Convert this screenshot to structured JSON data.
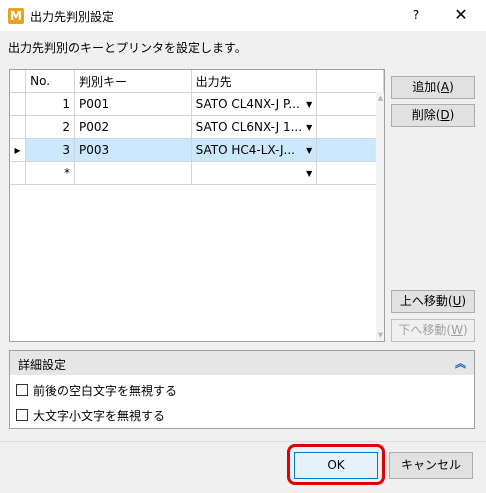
{
  "window": {
    "icon_letter": "M",
    "title": "出力先判別設定",
    "help_label": "?",
    "close_label": "✕"
  },
  "description": "出力先判別のキーとプリンタを設定します。",
  "grid": {
    "columns": [
      "No.",
      "判別キー",
      "出力先"
    ],
    "rows": [
      {
        "no": "1",
        "key": "P001",
        "dest": "SATO CL4NX-J P...",
        "selected": false
      },
      {
        "no": "2",
        "key": "P002",
        "dest": "SATO CL6NX-J 1...",
        "selected": false
      },
      {
        "no": "3",
        "key": "P003",
        "dest": "SATO HC4-LX-J...",
        "selected": true
      }
    ],
    "new_row_marker": "*",
    "current_row_marker": "▸",
    "dropdown_arrow": "▼",
    "scroll_up": "▲",
    "scroll_down": "▼"
  },
  "side_buttons": {
    "add": {
      "text": "追加(",
      "key": "A",
      "end": ")"
    },
    "delete": {
      "text": "削除(",
      "key": "D",
      "end": ")"
    },
    "move_up": {
      "text": "上へ移動(",
      "key": "U",
      "end": ")"
    },
    "move_down": {
      "text": "下へ移動(",
      "key": "W",
      "end": ")"
    }
  },
  "detail": {
    "title": "詳細設定",
    "collapse_icon": "︽",
    "options": [
      {
        "label": "前後の空白文字を無視する",
        "checked": false
      },
      {
        "label": "大文字小文字を無視する",
        "checked": false
      }
    ]
  },
  "footer": {
    "ok_label": "OK",
    "cancel_label": "キャンセル"
  },
  "colors": {
    "selection": "#cce8ff",
    "highlight": "#e00000",
    "app_icon": "#e8a21b"
  }
}
